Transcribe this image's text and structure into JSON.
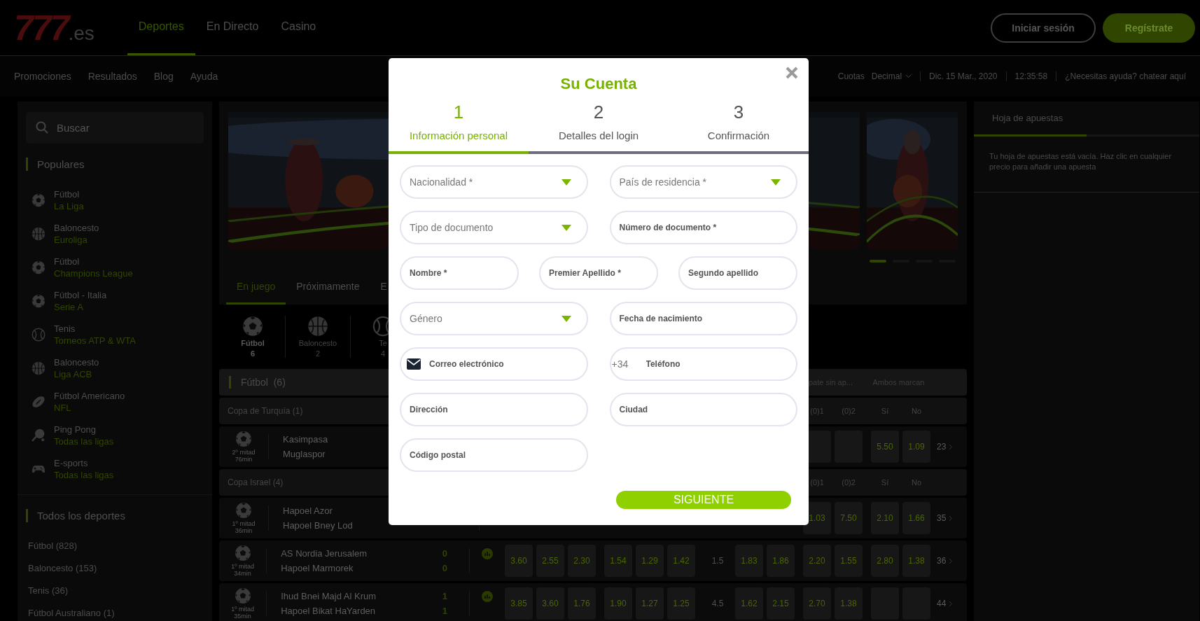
{
  "header": {
    "logo": {
      "digits": "777",
      "suffix": ".es"
    },
    "nav": [
      {
        "label": "Deportes",
        "selected": true
      },
      {
        "label": "En Directo",
        "selected": false
      },
      {
        "label": "Casino",
        "selected": false
      }
    ],
    "buttons": [
      {
        "label": "Iniciar sesión",
        "kind": "outline"
      },
      {
        "label": "Regístrate",
        "kind": "primary"
      }
    ]
  },
  "subnav": {
    "links": [
      "Promociones",
      "Resultados",
      "Blog",
      "Ayuda"
    ],
    "odds_label": "Cuotas",
    "odds_format": "Decimal",
    "date": "Dic. 15 Mar., 2020",
    "time": "12:35:58",
    "help": "¿Necesitas ayuda? chatear aquí"
  },
  "sidebar": {
    "search": {
      "placeholder": "Buscar"
    },
    "popular_title": "Populares",
    "popular": [
      {
        "kind": "soccer",
        "sport": "Fútbol",
        "league": "La Liga"
      },
      {
        "kind": "basketball",
        "sport": "Baloncesto",
        "league": "Euroliga"
      },
      {
        "kind": "soccer",
        "sport": "Fútbol",
        "league": "Champions League"
      },
      {
        "kind": "soccer",
        "sport": "Fútbol - Italia",
        "league": "Serie A"
      },
      {
        "kind": "tennis",
        "sport": "Tenis",
        "league": "Torneos ATP & WTA"
      },
      {
        "kind": "basketball",
        "sport": "Baloncesto",
        "league": "Liga ACB"
      },
      {
        "kind": "american-football",
        "sport": "Fútbol Americano",
        "league": "NFL"
      },
      {
        "kind": "ping-pong",
        "sport": "Ping Pong",
        "league": "Todas las ligas"
      },
      {
        "kind": "esports",
        "sport": "E-sports",
        "league": "Todas las ligas"
      }
    ],
    "all_title": "Todos los deportes",
    "all": [
      "Fútbol (828)",
      "Baloncesto (153)",
      "Tenis (36)",
      "Fútbol Australiano (1)"
    ]
  },
  "main": {
    "carousel": [
      {
        "selected": true
      },
      {
        "selected": false
      },
      {
        "selected": false
      },
      {
        "selected": false
      }
    ],
    "tabs": [
      {
        "label": "En juego",
        "selected": true
      },
      {
        "label": "Próximamente",
        "selected": false
      },
      {
        "label": "E",
        "selected": false
      }
    ],
    "sports": [
      {
        "kind": "soccer",
        "name": "Fútbol",
        "count": "6",
        "selected": true
      },
      {
        "kind": "basketball",
        "name": "Baloncesto",
        "count": "2",
        "selected": false
      },
      {
        "kind": "tennis",
        "name": "Te",
        "count": "4",
        "selected": false
      }
    ],
    "section": {
      "title": "Fútbol",
      "count": "(6)",
      "markets": [
        "pate sin ap...",
        "Ambos marcan"
      ]
    },
    "leagues": [
      {
        "name": "Copa de Turquía (1)",
        "columns": [
          "(0)1",
          "(0)2",
          "Sí",
          "No"
        ],
        "matches": [
          {
            "period": "2º mitad",
            "minute": "76min",
            "teams": [
              "Kasimpasa",
              "Muglaspor"
            ],
            "odds": [
              {
                "kind": "empty"
              },
              {
                "kind": "empty"
              },
              {
                "kind": "price",
                "value": "5.50"
              },
              {
                "kind": "price",
                "value": "1.09"
              }
            ],
            "more": "23"
          }
        ]
      },
      {
        "name": "Copa Israel (4)",
        "columns": [
          "(0)1",
          "(0)2",
          "Sí",
          "No"
        ],
        "matches": [
          {
            "period": "1º mitad",
            "minute": "36min",
            "teams": [
              "Hapoel Azor",
              "Hapoel Bney Lod"
            ],
            "odds": [
              {
                "kind": "price",
                "value": "1.03"
              },
              {
                "kind": "price",
                "value": "7.50"
              },
              {
                "kind": "price",
                "value": "2.10"
              },
              {
                "kind": "price",
                "value": "1.66"
              }
            ],
            "more": "35"
          },
          {
            "period": "1º mitad",
            "minute": "34min",
            "teams": [
              "AS Nordia Jerusalem",
              "Hapoel Marmorek"
            ],
            "scores": [
              "0",
              "0"
            ],
            "stats": true,
            "odds": [
              {
                "kind": "price",
                "value": "3.60"
              },
              {
                "kind": "price",
                "value": "2.55"
              },
              {
                "kind": "price",
                "value": "2.30"
              },
              {
                "kind": "price",
                "value": "1.54"
              },
              {
                "kind": "price",
                "value": "1.29"
              },
              {
                "kind": "price",
                "value": "1.42"
              },
              {
                "kind": "line",
                "value": "1.5"
              },
              {
                "kind": "price",
                "value": "1.83"
              },
              {
                "kind": "price",
                "value": "1.86"
              },
              {
                "kind": "price",
                "value": "2.20"
              },
              {
                "kind": "price",
                "value": "1.55"
              },
              {
                "kind": "price",
                "value": "2.80"
              },
              {
                "kind": "price",
                "value": "1.38"
              }
            ],
            "more": "36"
          },
          {
            "period": "1º mitad",
            "minute": "35min",
            "teams": [
              "Ihud Bnei Majd Al Krum",
              "Hapoel Bikat HaYarden"
            ],
            "scores": [
              "1",
              "1"
            ],
            "stats": true,
            "odds": [
              {
                "kind": "price",
                "value": "3.85"
              },
              {
                "kind": "price",
                "value": "3.60"
              },
              {
                "kind": "price",
                "value": "1.76"
              },
              {
                "kind": "price",
                "value": "1.90"
              },
              {
                "kind": "price",
                "value": "1.27"
              },
              {
                "kind": "price",
                "value": "1.25"
              },
              {
                "kind": "line",
                "value": "4.5"
              },
              {
                "kind": "price",
                "value": "1.62"
              },
              {
                "kind": "price",
                "value": "2.15"
              },
              {
                "kind": "price",
                "value": "2.70"
              },
              {
                "kind": "price",
                "value": "1.38"
              },
              {
                "kind": "empty"
              },
              {
                "kind": "empty"
              }
            ],
            "more": "44"
          }
        ]
      }
    ]
  },
  "betslip": {
    "title": "Hoja de apuestas",
    "tabs": [
      {
        "selected": true
      },
      {
        "selected": false
      }
    ],
    "message": "Tu hoja de apuestas está vacía. Haz clic en cualquier precio para añadir una apuesta"
  },
  "modal": {
    "title": "Su Cuenta",
    "steps": [
      {
        "number": "1",
        "label": "Información personal",
        "selected": true
      },
      {
        "number": "2",
        "label": "Detalles del login",
        "selected": false
      },
      {
        "number": "3",
        "label": "Confirmación",
        "selected": false
      }
    ],
    "rows": [
      [
        {
          "kind": "select",
          "placeholder": "Nacionalidad *"
        },
        {
          "kind": "select",
          "placeholder": "País de residencia *"
        }
      ],
      [
        {
          "kind": "select",
          "placeholder": "Tipo de documento"
        },
        {
          "kind": "text",
          "placeholder": "Número de documento *"
        }
      ],
      [
        {
          "kind": "text",
          "placeholder": "Nombre *"
        },
        {
          "kind": "text",
          "placeholder": "Premier Apellido *"
        },
        {
          "kind": "text",
          "placeholder": "Segundo apellido"
        }
      ],
      [
        {
          "kind": "select",
          "placeholder": "Género"
        },
        {
          "kind": "text",
          "placeholder": "Fecha de nacimiento"
        }
      ],
      [
        {
          "kind": "email",
          "placeholder": "Correo electrónico"
        },
        {
          "kind": "phone",
          "prefix": "+34",
          "placeholder": "Teléfono"
        }
      ],
      [
        {
          "kind": "text",
          "placeholder": "Dirección"
        },
        {
          "kind": "text",
          "placeholder": "Ciudad"
        }
      ],
      [
        {
          "kind": "text",
          "placeholder": "Código postal"
        }
      ]
    ],
    "submit": "SIGUIENTE"
  }
}
